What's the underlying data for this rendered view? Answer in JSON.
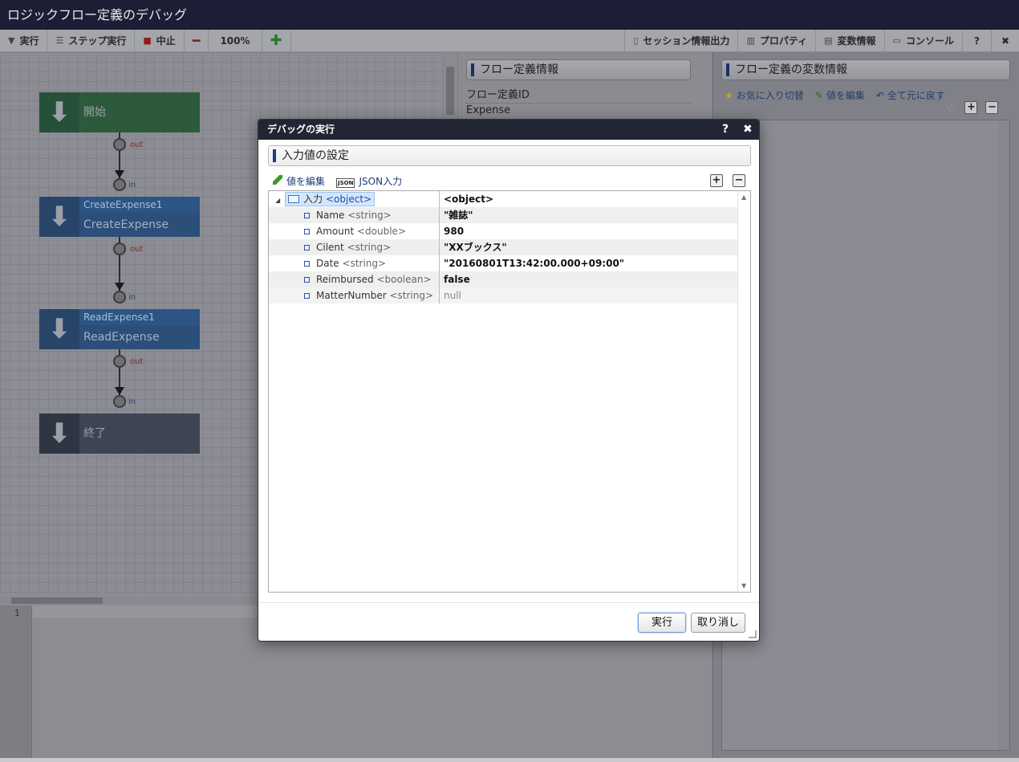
{
  "app": {
    "title": "ロジックフロー定義のデバッグ"
  },
  "toolbar": {
    "run": "実行",
    "step": "ステップ実行",
    "stop": "中止",
    "zoom": "100%",
    "session_output": "セッション情報出力",
    "properties": "プロパティ",
    "variables": "変数情報",
    "console": "コンソール",
    "help": "?",
    "close": "✖"
  },
  "flow": {
    "start_label": "開始",
    "end_label": "終了",
    "nodes": [
      {
        "top": "CreateExpense1",
        "main": "CreateExpense"
      },
      {
        "top": "ReadExpense1",
        "main": "ReadExpense"
      }
    ],
    "port_out": "out",
    "port_in": "in"
  },
  "editor": {
    "line_number": "1"
  },
  "flow_info": {
    "header": "フロー定義情報",
    "id_label": "フロー定義ID",
    "id_value": "Expense"
  },
  "variables_panel": {
    "header": "フロー定義の変数情報",
    "tools": {
      "favorite": "お気に入り切替",
      "edit": "値を編集",
      "reset": "全て元に戻す"
    }
  },
  "dialog": {
    "title": "デバッグの実行",
    "help": "?",
    "close": "✖",
    "section": "入力値の設定",
    "tools": {
      "edit": "値を編集",
      "json_icon": "JSON",
      "json": "JSON入力"
    },
    "root": {
      "name": "入力",
      "type": "<object>",
      "value": "<object>"
    },
    "rows": [
      {
        "name": "Name",
        "type": "<string>",
        "value": "\"雑誌\""
      },
      {
        "name": "Amount",
        "type": "<double>",
        "value": "980"
      },
      {
        "name": "Cilent",
        "type": "<string>",
        "value": "\"XXブックス\""
      },
      {
        "name": "Date",
        "type": "<string>",
        "value": "\"20160801T13:42:00.000+09:00\""
      },
      {
        "name": "Reimbursed",
        "type": "<boolean>",
        "value": "false"
      },
      {
        "name": "MatterNumber",
        "type": "<string>",
        "value": "null"
      }
    ],
    "run_button": "実行",
    "cancel_button": "取り消し"
  },
  "colors": {
    "accent": "#1f3a8a",
    "titlebar": "#1d1d35"
  }
}
